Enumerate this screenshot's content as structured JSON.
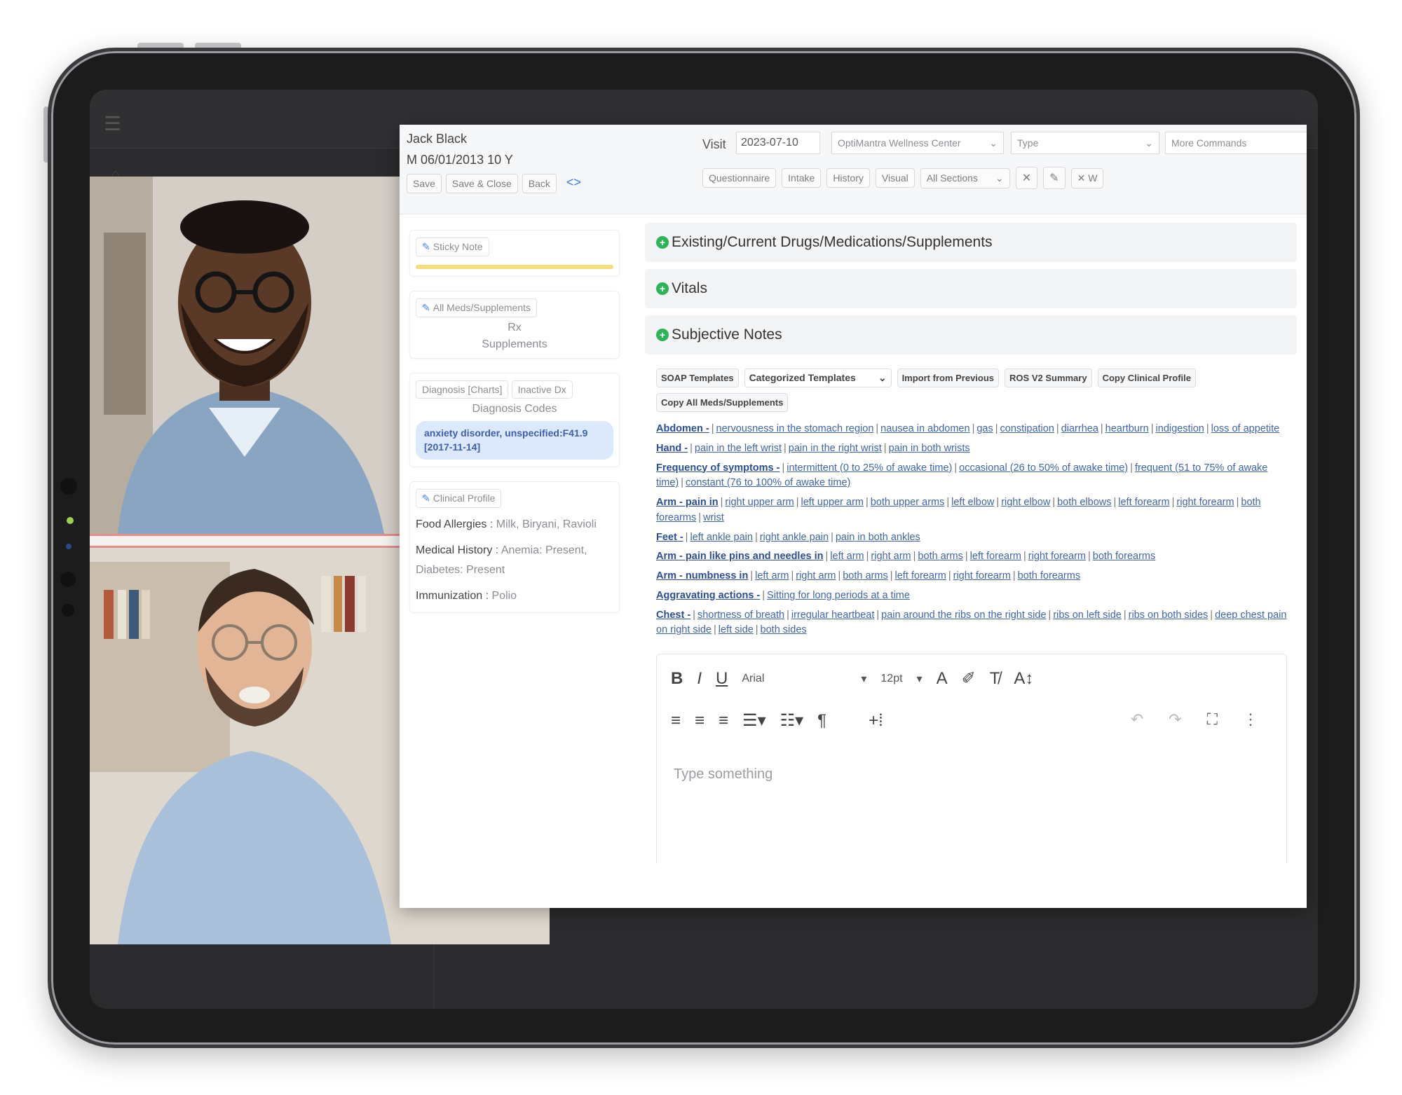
{
  "ehr": {
    "patient": {
      "name": "Jack Black",
      "info": "M 06/01/2013 10 Y"
    },
    "header_buttons": [
      "Save",
      "Save & Close",
      "Back"
    ],
    "visit": {
      "label": "Visit",
      "date": "2023-07-10",
      "center": "OptiMantra Wellness Center",
      "type_placeholder": "Type",
      "more_commands": "More Commands"
    },
    "row2_buttons": [
      "Questionnaire",
      "Intake",
      "History",
      "Visual"
    ],
    "sections_select": "All Sections",
    "w_label": "W",
    "left": {
      "sticky_note": "Sticky Note",
      "all_meds": "All Meds/Supplements",
      "rx": "Rx",
      "supplements": "Supplements",
      "dx_tabs": [
        "Diagnosis [Charts]",
        "Inactive Dx"
      ],
      "diagnosis_codes": "Diagnosis Codes",
      "dx_chip": "anxiety disorder, unspecified:F41.9 [2017-11-14]",
      "clinical_profile": "Clinical Profile",
      "profile": [
        {
          "label": "Food Allergies",
          "value": "Milk, Biryani, Ravioli"
        },
        {
          "label": "Medical History",
          "value": "Anemia: Present, Diabetes: Present"
        },
        {
          "label": "Immunization",
          "value": "Polio"
        }
      ]
    },
    "sections": [
      "Existing/Current Drugs/Medications/Supplements",
      "Vitals",
      "Subjective Notes"
    ],
    "templates": {
      "soap": "SOAP Templates",
      "categorized": "Categorized Templates",
      "import": "Import from Previous",
      "ros": "ROS V2 Summary",
      "copy_profile": "Copy Clinical Profile",
      "copy_all": "Copy All Meds/Supplements"
    },
    "ros_lines": [
      {
        "head": "Abdomen -",
        "items": [
          "nervousness in the stomach region",
          "nausea in abdomen",
          "gas",
          "constipation",
          "diarrhea",
          "heartburn",
          "indigestion",
          "loss of appetite"
        ]
      },
      {
        "head": "Hand -",
        "items": [
          "pain in the left wrist",
          "pain in the right wrist",
          "pain in both wrists"
        ]
      },
      {
        "head": "Frequency of symptoms -",
        "items": [
          "intermittent (0 to 25% of awake time)",
          "occasional (26 to 50% of awake time)",
          "frequent (51 to 75% of awake time)",
          "constant (76 to 100% of awake time)"
        ]
      },
      {
        "head": "Arm - pain in",
        "items": [
          "right upper arm",
          "left upper arm",
          "both upper arms",
          "left elbow",
          "right elbow",
          "both elbows",
          "left forearm",
          "right forearm",
          "both forearms",
          "wrist"
        ]
      },
      {
        "head": "Feet -",
        "items": [
          "left ankle pain",
          "right ankle pain",
          "pain in both ankles"
        ]
      },
      {
        "head": "Arm - pain like pins and needles in",
        "items": [
          "left arm",
          "right arm",
          "both arms",
          "left forearm",
          "right forearm",
          "both forearms"
        ]
      },
      {
        "head": "Arm - numbness in",
        "items": [
          "left arm",
          "right arm",
          "both arms",
          "left forearm",
          "right forearm",
          "both forearms"
        ]
      },
      {
        "head": "Aggravating actions -",
        "items": [
          "Sitting for long periods at a time"
        ]
      },
      {
        "head": "Chest -",
        "items": [
          "shortness of breath",
          "irregular heartbeat",
          "pain around the ribs on the right side",
          "ribs on left side",
          "ribs on both sides",
          "deep chest pain on right side",
          "left side",
          "both sides"
        ]
      }
    ],
    "editor": {
      "font": "Arial",
      "size": "12pt",
      "placeholder": "Type something",
      "bold": "B",
      "italic": "I",
      "underline": "U"
    }
  },
  "colors": {
    "accent": "#3d7be8",
    "section_plus": "#2fb35a",
    "sticky": "#f5dd7a",
    "dx_chip": "#dce8fb"
  }
}
